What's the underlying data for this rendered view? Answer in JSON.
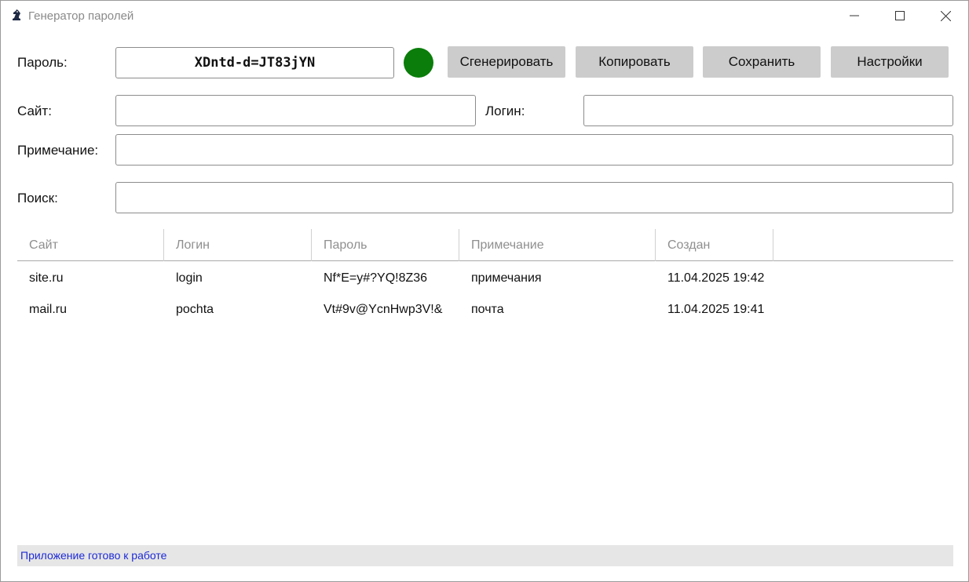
{
  "window": {
    "title": "Генератор паролей",
    "icon": "chess-knight-icon",
    "controls": {
      "minimize": "minimize-icon",
      "maximize": "maximize-icon",
      "close": "close-icon"
    }
  },
  "form": {
    "password_label": "Пароль:",
    "password_value": "XDntd-d=JT83jYN",
    "strength_color": "#0a7d0a",
    "site_label": "Сайт:",
    "site_value": "",
    "login_label": "Логин:",
    "login_value": "",
    "note_label": "Примечание:",
    "note_value": "",
    "search_label": "Поиск:",
    "search_value": ""
  },
  "buttons": {
    "generate": "Сгенерировать",
    "copy": "Копировать",
    "save": "Сохранить",
    "settings": "Настройки"
  },
  "table": {
    "columns": [
      "Сайт",
      "Логин",
      "Пароль",
      "Примечание",
      "Создан"
    ],
    "rows": [
      [
        "site.ru",
        "login",
        "Nf*E=y#?YQ!8Z36",
        "примечания",
        "11.04.2025 19:42"
      ],
      [
        "mail.ru",
        "pochta",
        "Vt#9v@YcnHwp3V!&",
        "почта",
        "11.04.2025 19:41"
      ]
    ]
  },
  "status": {
    "text": "Приложение готово к работе"
  }
}
